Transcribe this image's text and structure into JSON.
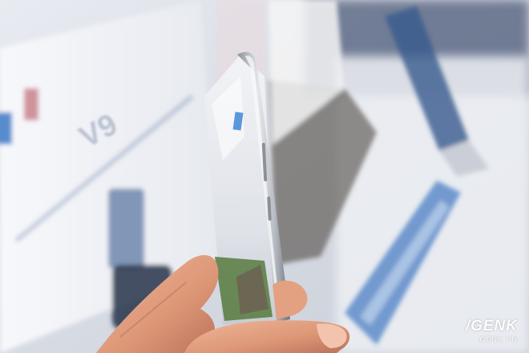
{
  "watermark": {
    "logo": "/GENK",
    "domain": "GENK.VN"
  },
  "display_brand": "V9",
  "colors": {
    "backdrop": "#dfe3ea",
    "panel": "#f4f6fa",
    "accent_blue": "#3a6fb5",
    "phone_frame": "#bfc3c9",
    "skin": "#e9a887"
  }
}
